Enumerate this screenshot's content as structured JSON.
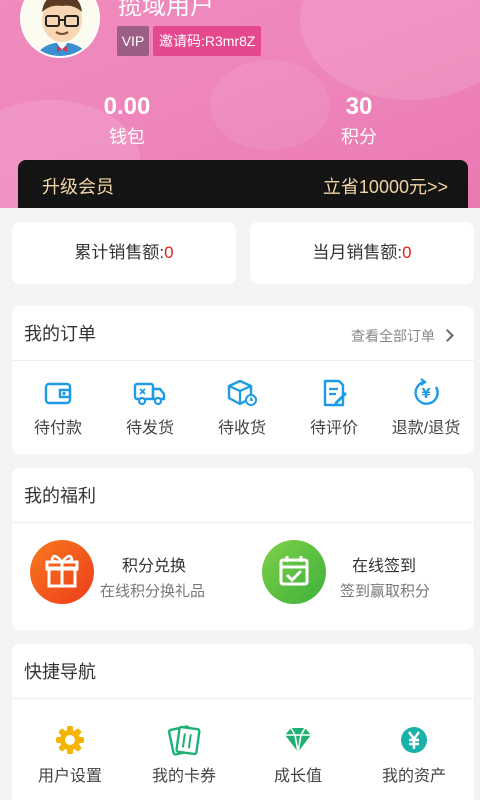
{
  "profile": {
    "nickname": "揽域用户",
    "vip_label": "VIP",
    "invite_code": "邀请码:R3mr8Z"
  },
  "stats": [
    {
      "value": "0.00",
      "label": "钱包"
    },
    {
      "value": "30",
      "label": "积分"
    }
  ],
  "vip_bar": {
    "left": "升级会员",
    "right": "立省10000元>>"
  },
  "sales": {
    "total_label": "累计销售额:",
    "total_value": "0",
    "month_label": "当月销售额:",
    "month_value": "0"
  },
  "orders": {
    "title": "我的订单",
    "view_all": "查看全部订单",
    "items": [
      {
        "label": "待付款",
        "icon": "wallet-icon"
      },
      {
        "label": "待发货",
        "icon": "truck-icon"
      },
      {
        "label": "待收货",
        "icon": "package-icon"
      },
      {
        "label": "待评价",
        "icon": "review-icon"
      },
      {
        "label": "退款/退货",
        "icon": "refund-icon"
      }
    ]
  },
  "benefits": {
    "title": "我的福利",
    "items": [
      {
        "title": "积分兑换",
        "desc": "在线积分换礼品",
        "icon": "gift-icon"
      },
      {
        "title": "在线签到",
        "desc": "签到赢取积分",
        "icon": "calendar-check-icon"
      }
    ]
  },
  "shortcuts": {
    "title": "快捷导航",
    "items": [
      {
        "label": "用户设置",
        "icon": "gear-icon"
      },
      {
        "label": "我的卡券",
        "icon": "coupon-icon"
      },
      {
        "label": "成长值",
        "icon": "diamond-icon"
      },
      {
        "label": "我的资产",
        "icon": "yen-coin-icon"
      }
    ]
  },
  "colors": {
    "header_pink": "#ee86bb",
    "vip_bar_bg": "#141414",
    "vip_bar_text": "#f3d4a4",
    "order_icon_blue": "#1e9be6",
    "gift_orange": "#f35418",
    "checkin_green": "#52b838",
    "shortcut_yellow": "#f5b400",
    "shortcut_green": "#1fb074",
    "shortcut_teal": "#1ab2a8",
    "sales_value_red": "#e02020"
  }
}
